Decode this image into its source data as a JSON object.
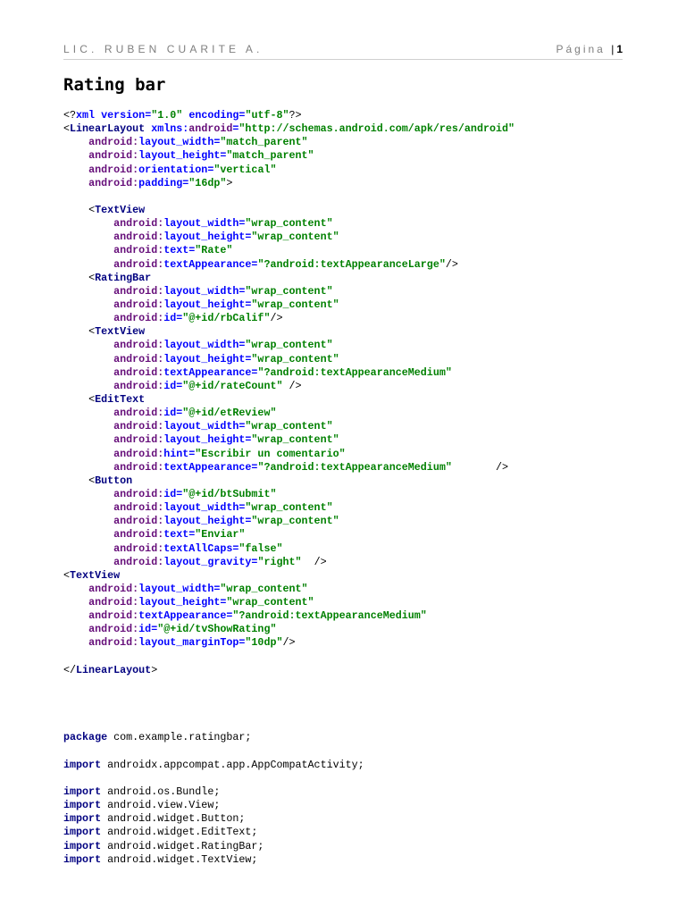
{
  "header": {
    "author": "LIC. RUBEN CUARITE A.",
    "page_label": "Página",
    "page_number": "1"
  },
  "title": "Rating bar",
  "xml_code": [
    "<?xml version=\"1.0\" encoding=\"utf-8\"?>",
    "<LinearLayout xmlns:android=\"http://schemas.android.com/apk/res/android\"",
    "    android:layout_width=\"match_parent\"",
    "    android:layout_height=\"match_parent\"",
    "    android:orientation=\"vertical\"",
    "    android:padding=\"16dp\">",
    "",
    "    <TextView",
    "        android:layout_width=\"wrap_content\"",
    "        android:layout_height=\"wrap_content\"",
    "        android:text=\"Rate\"",
    "        android:textAppearance=\"?android:textAppearanceLarge\"/>",
    "    <RatingBar",
    "        android:layout_width=\"wrap_content\"",
    "        android:layout_height=\"wrap_content\"",
    "        android:id=\"@+id/rbCalif\"/>",
    "    <TextView",
    "        android:layout_width=\"wrap_content\"",
    "        android:layout_height=\"wrap_content\"",
    "        android:textAppearance=\"?android:textAppearanceMedium\"",
    "        android:id=\"@+id/rateCount\" />",
    "    <EditText",
    "        android:id=\"@+id/etReview\"",
    "        android:layout_width=\"wrap_content\"",
    "        android:layout_height=\"wrap_content\"",
    "        android:hint=\"Escribir un comentario\"",
    "        android:textAppearance=\"?android:textAppearanceMedium\"       />",
    "    <Button",
    "        android:id=\"@+id/btSubmit\"",
    "        android:layout_width=\"wrap_content\"",
    "        android:layout_height=\"wrap_content\"",
    "        android:text=\"Enviar\"",
    "        android:textAllCaps=\"false\"",
    "        android:layout_gravity=\"right\"  />",
    "<TextView",
    "    android:layout_width=\"wrap_content\"",
    "    android:layout_height=\"wrap_content\"",
    "    android:textAppearance=\"?android:textAppearanceMedium\"",
    "    android:id=\"@+id/tvShowRating\"",
    "    android:layout_marginTop=\"10dp\"/>",
    "",
    "</LinearLayout>"
  ],
  "java_code": [
    "package com.example.ratingbar;",
    "",
    "import androidx.appcompat.app.AppCompatActivity;",
    "",
    "import android.os.Bundle;",
    "import android.view.View;",
    "import android.widget.Button;",
    "import android.widget.EditText;",
    "import android.widget.RatingBar;",
    "import android.widget.TextView;"
  ],
  "colors": {
    "tag": "#000080",
    "namespace": "#660e7a",
    "attribute": "#0000ff",
    "value": "#008000",
    "keyword": "#000080"
  }
}
